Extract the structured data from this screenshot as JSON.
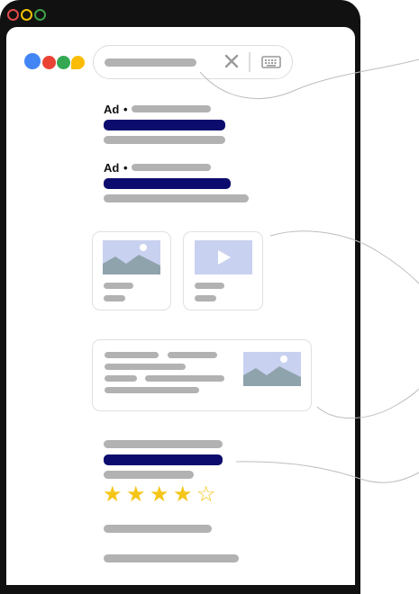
{
  "ads": {
    "label": "Ad",
    "separator": "•"
  },
  "rating": {
    "stars_total": 5,
    "stars_filled": 4,
    "filled_glyph": "★",
    "empty_glyph": "☆",
    "star_color": "#f5c518"
  },
  "icons": {
    "clear": "close-icon",
    "keyboard": "keyboard-icon",
    "play": "play-icon",
    "image": "image-icon"
  },
  "colors": {
    "frame": "#111111",
    "window_dot_red": "#e14b4b",
    "window_dot_yellow": "#f3c200",
    "window_dot_green": "#3ea24a",
    "logo_blue": "#4285f4",
    "logo_red": "#ea4335",
    "logo_green": "#34a853",
    "logo_yellow": "#fbbc05",
    "title_link": "#0c0c6e",
    "placeholder_text": "#b2b2b2",
    "image_thumb": "#8fa3ad",
    "video_thumb": "#c9d1f0"
  }
}
